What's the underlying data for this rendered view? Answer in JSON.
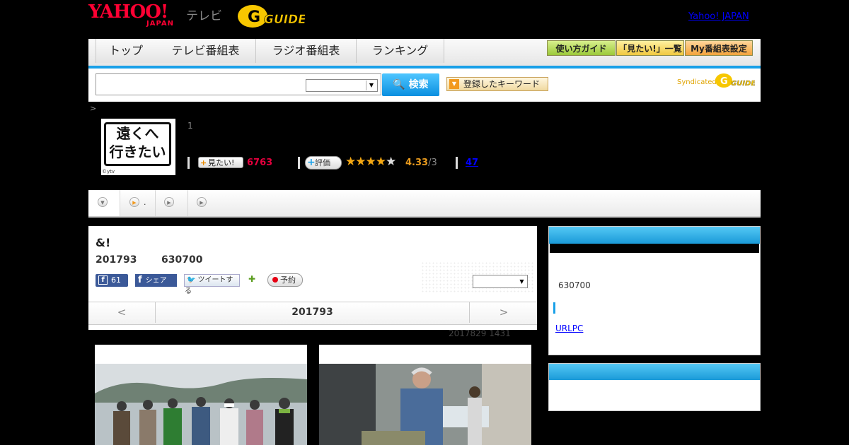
{
  "header": {
    "yahoo_logo": "YAHOO!",
    "japan_logo": "JAPAN",
    "tv_label": "テレビ",
    "gguide_logo": "G-GUIDE",
    "yahoo_japan_link": "Yahoo! JAPAN"
  },
  "nav": {
    "tabs": [
      "トップ",
      "テレビ番組表",
      "ラジオ番組表",
      "ランキング"
    ],
    "buttons": [
      "使い方ガイド",
      "「見たい!」一覧",
      "My番組表設定"
    ]
  },
  "search": {
    "placeholder": "",
    "button_label": "検索",
    "keyword_button": "登録したキーワード",
    "syndicated": "Syndicated"
  },
  "breadcrumb": ">",
  "program": {
    "thumb_text_line1": "遠くへ",
    "thumb_text_line2": "行きたい",
    "thumb_credit": "©ytv",
    "number": "1",
    "mitai_label": "見たい!",
    "mitai_count": "6763",
    "eval_label": "評価",
    "stars_filled": 4,
    "stars_total": 5,
    "rating": "4.33",
    "rating_max": "/3",
    "reviews": "47"
  },
  "tabs": {
    "tab2_label": "."
  },
  "episode": {
    "title": "&!",
    "date": "201793",
    "size": "630700",
    "fb_like_count": "61",
    "fb_share_label": "シェア",
    "tweet_label": "ツイートする",
    "reserve_label": "予約",
    "pager_prev": "<",
    "pager_current": "201793",
    "pager_next": ">",
    "updated": "2017829  1431"
  },
  "sidebar": {
    "size": "630700",
    "link": "URLPC"
  },
  "colors": {
    "accent_blue": "#19a0e8",
    "yahoo_red": "#ff0033",
    "rating_orange": "#e89a1e",
    "mitai_pink": "#e4003d"
  }
}
